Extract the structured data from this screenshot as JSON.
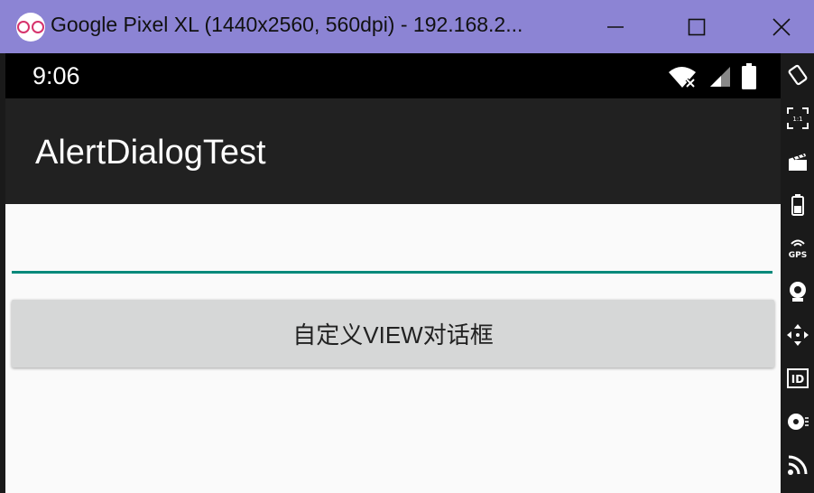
{
  "window": {
    "title": "Google Pixel XL (1440x2560, 560dpi) - 192.168.2...",
    "min_glyph": "—",
    "max_glyph": "☐",
    "close_glyph": "✕"
  },
  "statusbar": {
    "time": "9:06"
  },
  "appbar": {
    "title": "AlertDialogTest"
  },
  "main": {
    "input": {
      "value": ""
    },
    "button_label": "自定义VIEW对话框"
  },
  "sidebar": {
    "gps_label": "GPS",
    "id_label": "ID",
    "ratio_label": "1:1"
  },
  "colors": {
    "titlebar": "#8c84d4",
    "appbar": "#212121",
    "accent": "#00897b",
    "button": "#d6d7d7"
  }
}
